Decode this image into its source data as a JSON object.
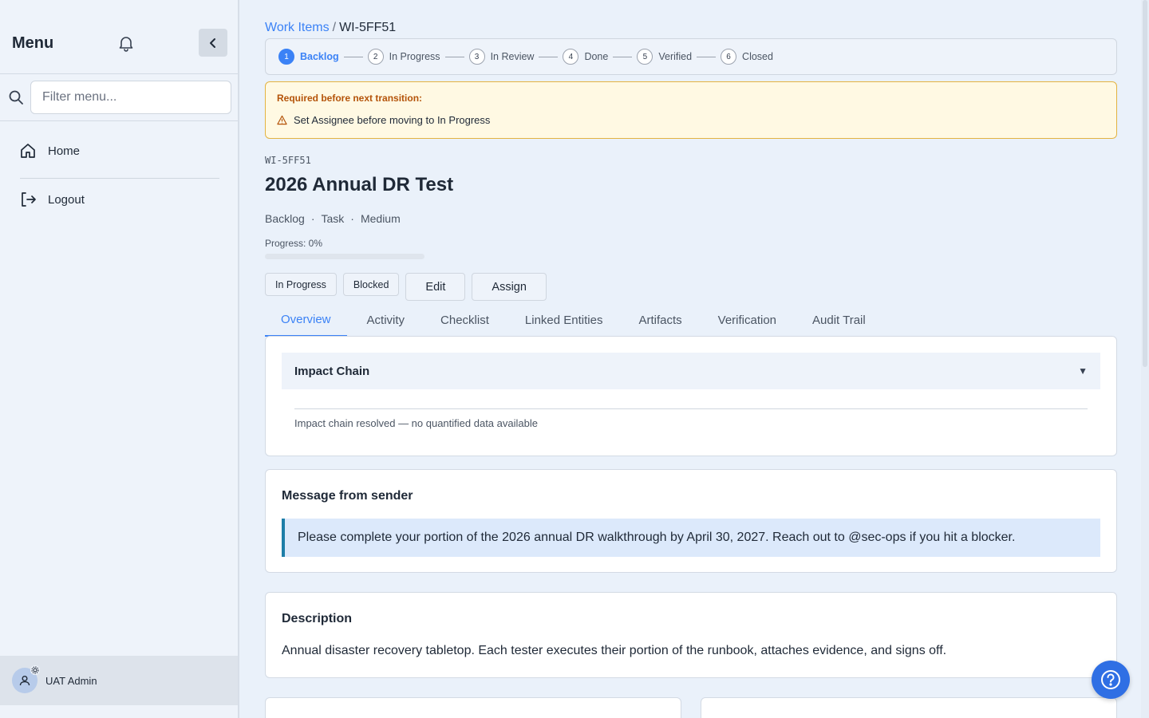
{
  "sidebar": {
    "title": "Menu",
    "filter_placeholder": "Filter menu...",
    "items": [
      {
        "label": "Home",
        "icon": "home-icon"
      },
      {
        "label": "Logout",
        "icon": "logout-icon"
      }
    ],
    "user": {
      "name": "UAT Admin"
    }
  },
  "breadcrumb": {
    "parent": "Work Items",
    "separator": "/",
    "current": "WI-5FF51"
  },
  "stepper": [
    {
      "num": "1",
      "label": "Backlog",
      "active": true
    },
    {
      "num": "2",
      "label": "In Progress"
    },
    {
      "num": "3",
      "label": "In Review"
    },
    {
      "num": "4",
      "label": "Done"
    },
    {
      "num": "5",
      "label": "Verified"
    },
    {
      "num": "6",
      "label": "Closed"
    }
  ],
  "warning": {
    "title": "Required before next transition:",
    "message": "Set Assignee before moving to In Progress"
  },
  "item": {
    "id": "WI-5FF51",
    "title": "2026 Annual DR Test",
    "status": "Backlog",
    "type": "Task",
    "priority": "Medium",
    "meta_sep": "·",
    "progress_label": "Progress: 0%",
    "progress_value": 0
  },
  "actions": {
    "in_progress": "In Progress",
    "blocked": "Blocked",
    "edit": "Edit",
    "assign": "Assign"
  },
  "tabs": [
    {
      "label": "Overview",
      "active": true
    },
    {
      "label": "Activity"
    },
    {
      "label": "Checklist"
    },
    {
      "label": "Linked Entities"
    },
    {
      "label": "Artifacts"
    },
    {
      "label": "Verification"
    },
    {
      "label": "Audit Trail"
    }
  ],
  "impact": {
    "title": "Impact Chain",
    "toggle": "▼",
    "text": "Impact chain resolved — no quantified data available"
  },
  "message": {
    "title": "Message from sender",
    "body": "Please complete your portion of the 2026 annual DR walkthrough by April 30, 2027. Reach out to @sec-ops if you hit a blocker."
  },
  "description": {
    "title": "Description",
    "body": "Annual disaster recovery tabletop. Each tester executes their portion of the runbook, attaches evidence, and signs off."
  },
  "colors": {
    "accent": "#3b82f6",
    "warning_border": "#e3b341",
    "warning_text": "#b45309",
    "message_border": "#1d7ea8"
  }
}
